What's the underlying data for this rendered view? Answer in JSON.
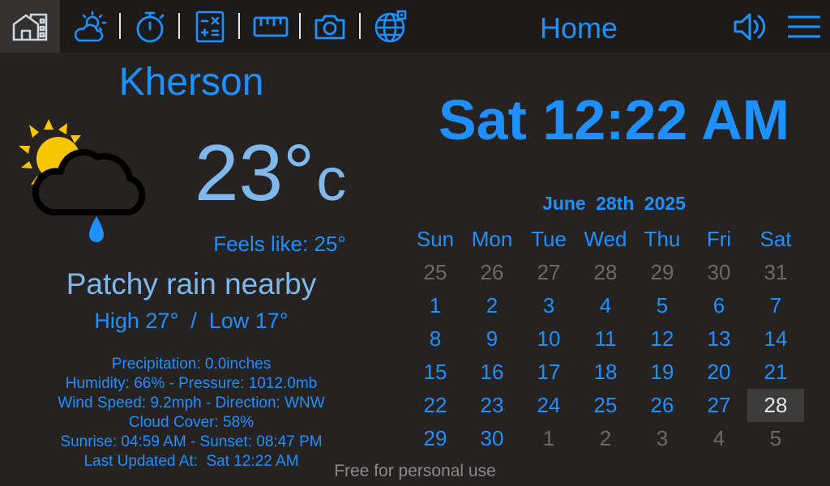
{
  "nav": {
    "items": [
      {
        "name": "home-icon",
        "active": true
      },
      {
        "name": "weather-icon"
      },
      {
        "name": "stopwatch-icon"
      },
      {
        "name": "calculator-icon"
      },
      {
        "name": "ruler-icon"
      },
      {
        "name": "camera-icon"
      },
      {
        "name": "globe-icon"
      }
    ],
    "title": "Home",
    "right": [
      "volume-icon",
      "menu-icon"
    ]
  },
  "weather": {
    "city": "Kherson",
    "temp_value": "23",
    "temp_degree": "°",
    "temp_unit": "c",
    "feels_like": "Feels like: 25°",
    "condition": "Patchy rain nearby",
    "high_low": "High 27°  /  Low 17°",
    "icon": "sun-cloud-rain-icon",
    "details": [
      "Precipitation: 0.0inches",
      "Humidity: 66% - Pressure: 1012.0mb",
      "Wind Speed: 9.2mph - Direction: WNW",
      "Cloud Cover: 58%",
      "Sunrise: 04:59 AM - Sunset: 08:47 PM",
      "Last Updated At:  Sat 12:22 AM"
    ]
  },
  "clock": {
    "time": "Sat 12:22 AM"
  },
  "calendar": {
    "month_label": "June  28th  2025",
    "weekdays": [
      "Sun",
      "Mon",
      "Tue",
      "Wed",
      "Thu",
      "Fri",
      "Sat"
    ],
    "weeks": [
      [
        {
          "d": "25",
          "t": "other"
        },
        {
          "d": "26",
          "t": "other"
        },
        {
          "d": "27",
          "t": "other"
        },
        {
          "d": "28",
          "t": "other"
        },
        {
          "d": "29",
          "t": "other"
        },
        {
          "d": "30",
          "t": "other"
        },
        {
          "d": "31",
          "t": "other"
        }
      ],
      [
        {
          "d": "1",
          "t": "cur"
        },
        {
          "d": "2",
          "t": "cur"
        },
        {
          "d": "3",
          "t": "cur"
        },
        {
          "d": "4",
          "t": "cur"
        },
        {
          "d": "5",
          "t": "cur"
        },
        {
          "d": "6",
          "t": "cur"
        },
        {
          "d": "7",
          "t": "cur"
        }
      ],
      [
        {
          "d": "8",
          "t": "cur"
        },
        {
          "d": "9",
          "t": "cur"
        },
        {
          "d": "10",
          "t": "cur"
        },
        {
          "d": "11",
          "t": "cur"
        },
        {
          "d": "12",
          "t": "cur"
        },
        {
          "d": "13",
          "t": "cur"
        },
        {
          "d": "14",
          "t": "cur"
        }
      ],
      [
        {
          "d": "15",
          "t": "cur"
        },
        {
          "d": "16",
          "t": "cur"
        },
        {
          "d": "17",
          "t": "cur"
        },
        {
          "d": "18",
          "t": "cur"
        },
        {
          "d": "19",
          "t": "cur"
        },
        {
          "d": "20",
          "t": "cur"
        },
        {
          "d": "21",
          "t": "cur"
        }
      ],
      [
        {
          "d": "22",
          "t": "cur"
        },
        {
          "d": "23",
          "t": "cur"
        },
        {
          "d": "24",
          "t": "cur"
        },
        {
          "d": "25",
          "t": "cur"
        },
        {
          "d": "26",
          "t": "cur"
        },
        {
          "d": "27",
          "t": "cur"
        },
        {
          "d": "28",
          "t": "today"
        }
      ],
      [
        {
          "d": "29",
          "t": "cur"
        },
        {
          "d": "30",
          "t": "cur"
        },
        {
          "d": "1",
          "t": "other"
        },
        {
          "d": "2",
          "t": "other"
        },
        {
          "d": "3",
          "t": "other"
        },
        {
          "d": "4",
          "t": "other"
        },
        {
          "d": "5",
          "t": "other"
        }
      ]
    ]
  },
  "footer": "Free for personal use",
  "colors": {
    "accent": "#1e90ff",
    "light_blue": "#7fb8ec",
    "background": "#272222",
    "topbar": "#1d1a1a"
  }
}
